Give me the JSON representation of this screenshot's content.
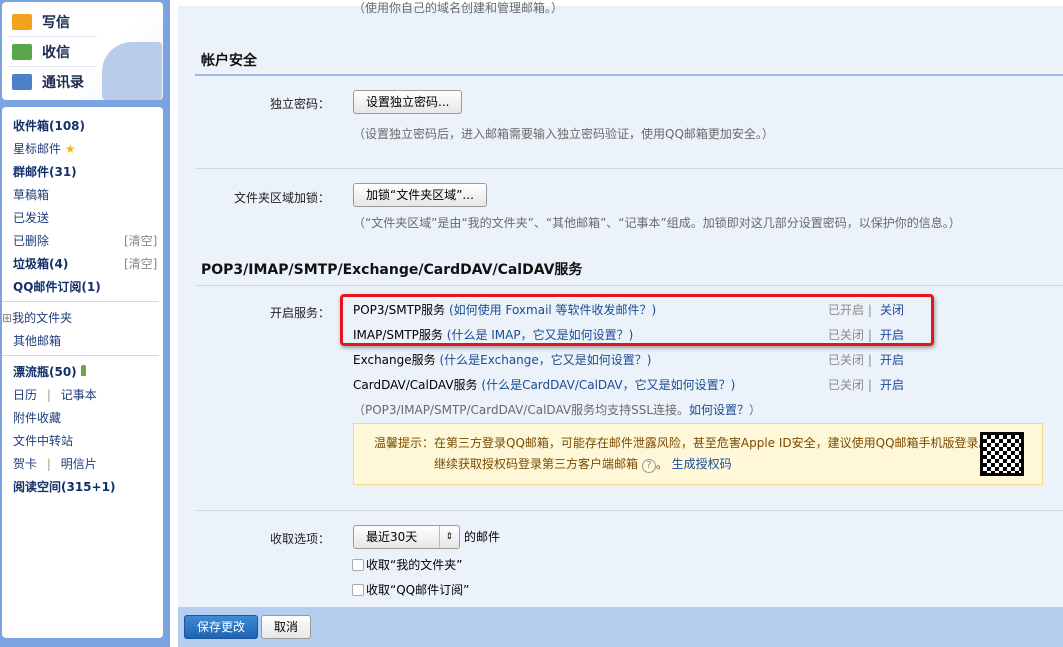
{
  "sidebar": {
    "nav": [
      {
        "label": "写信",
        "icon": "compose-icon"
      },
      {
        "label": "收信",
        "icon": "inbox-download-icon"
      },
      {
        "label": "通讯录",
        "icon": "contacts-icon"
      }
    ],
    "folders": {
      "inbox": "收件箱(108)",
      "starred": "星标邮件",
      "group": "群邮件(31)",
      "drafts": "草稿箱",
      "sent": "已发送",
      "deleted": "已删除",
      "spam": "垃圾箱(4)",
      "subscriptions": "QQ邮件订阅(1)",
      "clear": "[清空]",
      "my_folders": "我的文件夹",
      "other_mailboxes": "其他邮箱",
      "bottle": "漂流瓶(50)",
      "calendar": "日历",
      "notes": "记事本",
      "attachments": "附件收藏",
      "file_transfer": "文件中转站",
      "cards": "贺卡",
      "postcards": "明信片",
      "reading": "阅读空间(315+1)",
      "divider": "|"
    }
  },
  "main": {
    "top_cut_text": "（使用你自己的域名创建和管理邮箱。）",
    "account_security": {
      "title": "帐户安全",
      "password_label": "独立密码：",
      "password_button": "设置独立密码...",
      "password_hint": "（设置独立密码后，进入邮箱需要输入独立密码验证，使用QQ邮箱更加安全。）",
      "lock_label": "文件夹区域加锁：",
      "lock_button": "加锁“文件夹区域”...",
      "lock_hint": "（“文件夹区域”是由“我的文件夹”、“其他邮箱”、“记事本”组成。加锁即对这几部分设置密码，以保护你的信息。）"
    },
    "services": {
      "title": "POP3/IMAP/SMTP/Exchange/CardDAV/CalDAV服务",
      "label": "开启服务：",
      "items": [
        {
          "name": "POP3/SMTP服务",
          "help": "如何使用 Foxmail 等软件收发邮件？",
          "status": "已开启 |",
          "action": "关闭"
        },
        {
          "name": "IMAP/SMTP服务",
          "help": "什么是 IMAP，它又是如何设置？",
          "status": "已关闭 |",
          "action": "开启"
        },
        {
          "name": "Exchange服务",
          "help": "什么是Exchange，它又是如何设置？",
          "status": "已关闭 |",
          "action": "开启"
        },
        {
          "name": "CardDAV/CalDAV服务",
          "help": "什么是CardDAV/CalDAV，它又是如何设置？",
          "status": "已关闭 |",
          "action": "开启"
        }
      ],
      "ssl_note": "（POP3/IMAP/SMTP/CardDAV/CalDAV服务均支持SSL连接。",
      "ssl_link": "如何设置？",
      "ssl_close": "）",
      "tip_label": "温馨提示：",
      "tip_text": "在第三方登录QQ邮箱，可能存在邮件泄露风险，甚至危害Apple ID安全，建议使用QQ邮箱手机版登录。",
      "tip_text2": "继续获取授权码登录第三方客户端邮箱",
      "tip_link": "生成授权码"
    },
    "fetch": {
      "label": "收取选项：",
      "select_value": "最近30天",
      "suffix": "的邮件",
      "opt1": "收取“我的文件夹”",
      "opt1_checked": false,
      "opt2": "收取“QQ邮件订阅”",
      "opt2_checked": false
    },
    "footer": {
      "save": "保存更改",
      "cancel": "取消"
    }
  },
  "colors": {
    "accent": "#1d4b94",
    "highlight": "#e8141b",
    "save_button": "#1f6fc0"
  }
}
